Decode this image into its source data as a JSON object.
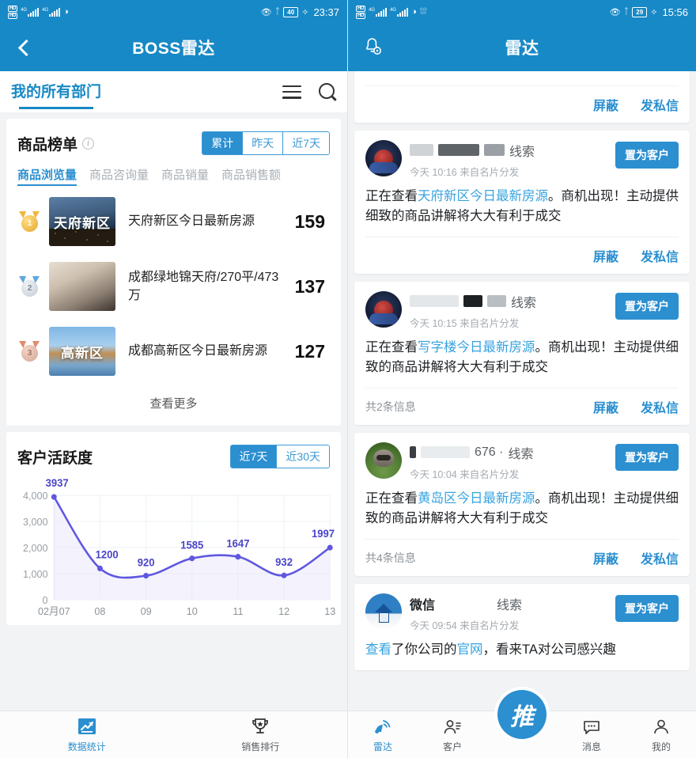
{
  "left": {
    "status": {
      "time": "23:37",
      "battery": "40",
      "hd1": "HD",
      "hd2": "HD",
      "net1": "4G",
      "net2": "4G"
    },
    "nav": {
      "title": "BOSS雷达",
      "back_icon": "chevron-left-icon"
    },
    "dept": {
      "label": "我的所有部门",
      "menu_icon": "hamburger-icon",
      "search_icon": "search-icon"
    },
    "rank_card": {
      "title": "商品榜单",
      "info_icon": "info-icon",
      "ranges": [
        {
          "label": "累计",
          "active": true
        },
        {
          "label": "昨天",
          "active": false
        },
        {
          "label": "近7天",
          "active": false
        }
      ],
      "metrics": [
        {
          "label": "商品浏览量",
          "active": true
        },
        {
          "label": "商品咨询量",
          "active": false
        },
        {
          "label": "商品销量",
          "active": false
        },
        {
          "label": "商品销售额",
          "active": false
        }
      ],
      "rows": [
        {
          "rank": "1",
          "thumb_text": "天府新区",
          "name": "天府新区今日最新房源",
          "value": "159"
        },
        {
          "rank": "2",
          "thumb_text": "",
          "name": "成都绿地锦天府/270平/473万",
          "value": "137"
        },
        {
          "rank": "3",
          "thumb_text": "高新区",
          "name": "成都高新区今日最新房源",
          "value": "127"
        }
      ],
      "more_label": "查看更多"
    },
    "chart_card": {
      "title": "客户活跃度",
      "ranges": [
        {
          "label": "近7天",
          "active": true
        },
        {
          "label": "近30天",
          "active": false
        }
      ]
    },
    "tabbar": [
      {
        "label": "数据统计",
        "icon": "chart-trend-icon",
        "active": true
      },
      {
        "label": "销售排行",
        "icon": "trophy-icon",
        "active": false
      }
    ]
  },
  "chart_data": {
    "type": "line",
    "title": "客户活跃度",
    "xlabel": "",
    "ylabel": "",
    "categories": [
      "02月07",
      "08",
      "09",
      "10",
      "11",
      "12",
      "13"
    ],
    "values": [
      3937,
      1200,
      920,
      1585,
      1647,
      932,
      1997
    ],
    "point_labels": [
      "3937",
      "1200",
      "920",
      "1585",
      "1647",
      "932",
      "1997"
    ],
    "yticks": [
      "0",
      "1,000",
      "2,000",
      "3,000",
      "4,000"
    ],
    "ylim": [
      0,
      4000
    ],
    "grid": true,
    "legend": "none",
    "line_color": "#5f57e0",
    "area_fill": "#e9e8fb",
    "label_color": "#4a45c8"
  },
  "right": {
    "status": {
      "time": "15:56",
      "battery": "29",
      "hd1": "HD",
      "hd2": "HD",
      "net1": "4G",
      "net2": "4G"
    },
    "nav": {
      "title": "雷达",
      "bell_icon": "bell-settings-icon"
    },
    "clipped_card": {
      "block_label": "屏蔽",
      "message_label": "发私信"
    },
    "cards": [
      {
        "avatar": "hero-avatar",
        "redacted": true,
        "name_prefix": "",
        "tag": "线索",
        "time": "今天 10:16 来自名片分发",
        "action_label": "置为客户",
        "body_prefix": "正在查看",
        "body_link": "天府新区今日最新房源",
        "body_suffix": "。商机出现！主动提供细致的商品讲解将大大有利于成交",
        "count": "",
        "block_label": "屏蔽",
        "message_label": "发私信"
      },
      {
        "avatar": "hero-avatar",
        "redacted": true,
        "name_prefix": "",
        "tag": "线索",
        "time": "今天 10:15 来自名片分发",
        "action_label": "置为客户",
        "body_prefix": "正在查看",
        "body_link": "写字楼今日最新房源",
        "body_suffix": "。商机出现！主动提供细致的商品讲解将大大有利于成交",
        "count": "共2条信息",
        "count_num": "2",
        "block_label": "屏蔽",
        "message_label": "发私信"
      },
      {
        "avatar": "raccoon-avatar",
        "redacted": true,
        "name_prefix": "676 · ",
        "tag": "线索",
        "time": "今天 10:04 来自名片分发",
        "action_label": "置为客户",
        "body_prefix": "正在查看",
        "body_link": "黄岛区今日最新房源",
        "body_suffix": "。商机出现！主动提供细致的商品讲解将大大有利于成交",
        "count": "共4条信息",
        "count_num": "4",
        "block_label": "屏蔽",
        "message_label": "发私信"
      },
      {
        "avatar": "house-avatar",
        "redacted": false,
        "name_prefix": "微信",
        "tag": "线索",
        "time": "今天 09:54 来自名片分发",
        "action_label": "置为客户",
        "body_prefix": "",
        "body_link": "查看",
        "body_suffix": "了你公司的",
        "body_link2": "官网",
        "body_suffix2": "，看来TA对公司感兴趣",
        "count": "",
        "block_label": "屏蔽",
        "message_label": "发私信"
      }
    ],
    "fab": {
      "label": "推",
      "name": "push-fab"
    },
    "tabbar": [
      {
        "label": "雷达",
        "icon": "radar-icon",
        "active": true
      },
      {
        "label": "客户",
        "icon": "customer-icon",
        "active": false
      },
      {
        "label": "消息",
        "icon": "message-icon",
        "active": false
      },
      {
        "label": "我的",
        "icon": "profile-icon",
        "active": false
      }
    ]
  },
  "colors": {
    "brand_blue": "#1789c6",
    "accent_blue": "#2b8fd0",
    "link_blue": "#37a3e0",
    "chart_purple": "#5f57e0"
  }
}
